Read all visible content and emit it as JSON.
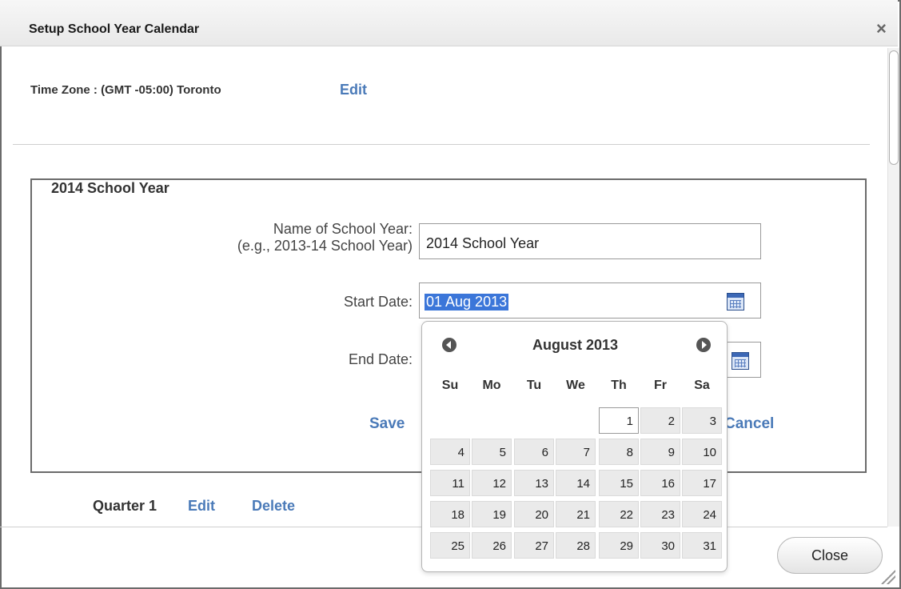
{
  "dialog": {
    "title": "Setup School Year Calendar",
    "close_label": "×",
    "close_button": "Close"
  },
  "timezone": {
    "label": "Time Zone : (GMT -05:00) Toronto",
    "edit": "Edit"
  },
  "school_year": {
    "legend": "2014 School Year",
    "name_label": "Name of School Year:",
    "name_hint": "(e.g., 2013-14 School Year)",
    "name_value": "2014 School Year",
    "start_label": "Start Date:",
    "start_value": "01 Aug 2013",
    "end_label": "End Date:",
    "save": "Save",
    "cancel": "Cancel"
  },
  "quarter": {
    "label": "Quarter 1",
    "edit": "Edit",
    "delete": "Delete"
  },
  "datepicker": {
    "month_label": "August 2013",
    "weekdays": [
      "Su",
      "Mo",
      "Tu",
      "We",
      "Th",
      "Fr",
      "Sa"
    ],
    "weeks": [
      [
        "",
        "",
        "",
        "",
        "1",
        "2",
        "3"
      ],
      [
        "4",
        "5",
        "6",
        "7",
        "8",
        "9",
        "10"
      ],
      [
        "11",
        "12",
        "13",
        "14",
        "15",
        "16",
        "17"
      ],
      [
        "18",
        "19",
        "20",
        "21",
        "22",
        "23",
        "24"
      ],
      [
        "25",
        "26",
        "27",
        "28",
        "29",
        "30",
        "31"
      ]
    ],
    "selected_day": "1"
  }
}
